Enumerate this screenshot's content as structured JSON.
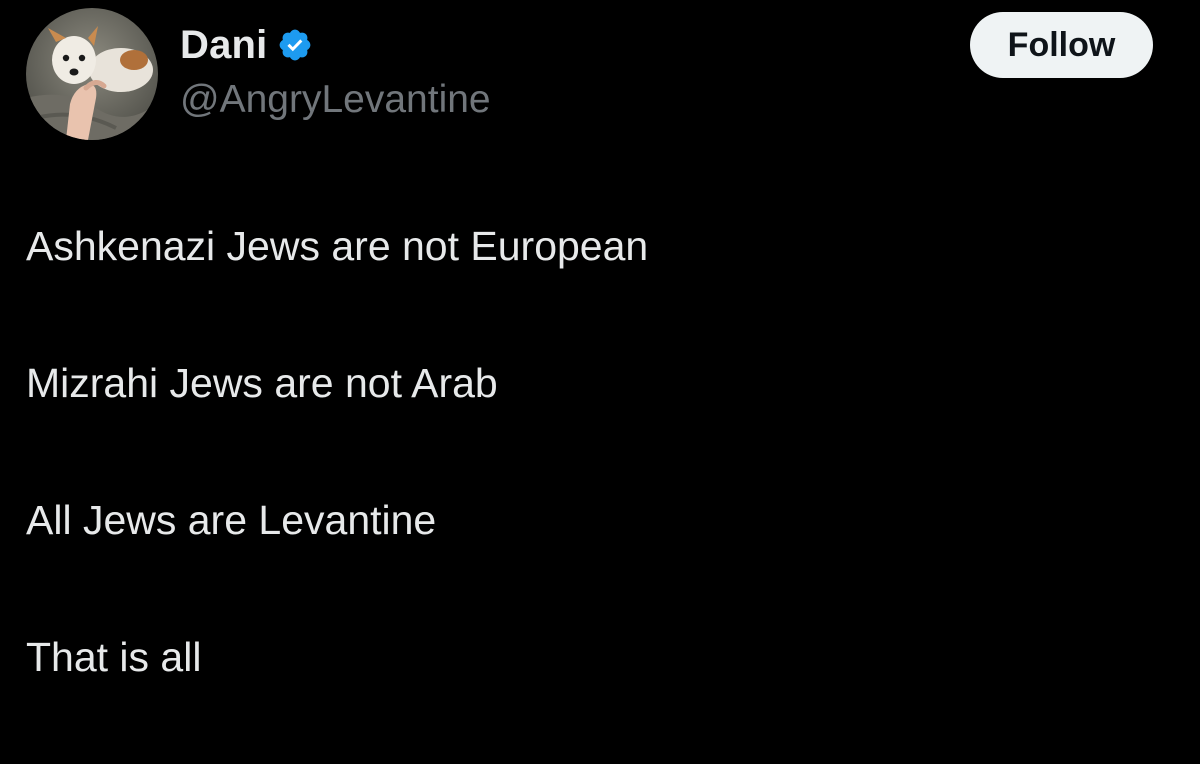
{
  "author": {
    "display_name": "Dani",
    "handle": "@AngryLevantine",
    "verified": true,
    "avatar_icon": "avatar-dog-photo"
  },
  "follow_button": {
    "label": "Follow"
  },
  "tweet": {
    "lines": [
      "Ashkenazi Jews are not European",
      "Mizrahi Jews are not Arab",
      "All Jews are Levantine",
      "That is all"
    ]
  },
  "colors": {
    "background": "#000000",
    "text_primary": "#e7e9ea",
    "text_secondary": "#71767b",
    "verified_badge": "#1d9bf0",
    "follow_button_bg": "#eff3f4",
    "follow_button_text": "#0f1419"
  }
}
